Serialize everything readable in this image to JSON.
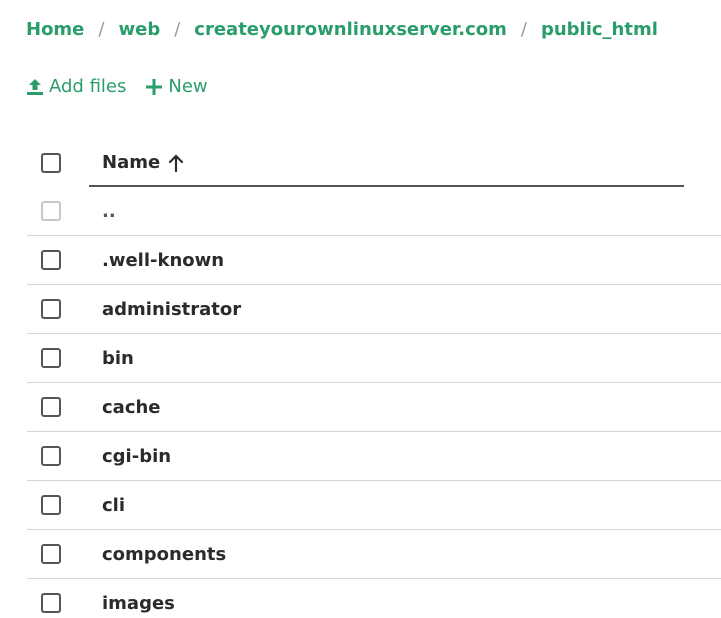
{
  "breadcrumb": {
    "items": [
      "Home",
      "web",
      "createyourownlinuxserver.com",
      "public_html"
    ],
    "separator": "/"
  },
  "toolbar": {
    "add_files_label": "Add files",
    "new_label": "New",
    "add_files_icon": "upload-icon",
    "new_icon": "plus-icon"
  },
  "table": {
    "header": {
      "name_label": "Name",
      "sort_icon": "arrow-up-icon"
    },
    "rows": [
      {
        "name": "..",
        "checkbox_enabled": false
      },
      {
        "name": ".well-known",
        "checkbox_enabled": true
      },
      {
        "name": "administrator",
        "checkbox_enabled": true
      },
      {
        "name": "bin",
        "checkbox_enabled": true
      },
      {
        "name": "cache",
        "checkbox_enabled": true
      },
      {
        "name": "cgi-bin",
        "checkbox_enabled": true
      },
      {
        "name": "cli",
        "checkbox_enabled": true
      },
      {
        "name": "components",
        "checkbox_enabled": true
      },
      {
        "name": "images",
        "checkbox_enabled": true
      }
    ]
  },
  "colors": {
    "accent": "#2a9d6b",
    "text": "#2b2b2b",
    "separator": "#9a9a9a",
    "row_border": "#d6d6d6"
  }
}
